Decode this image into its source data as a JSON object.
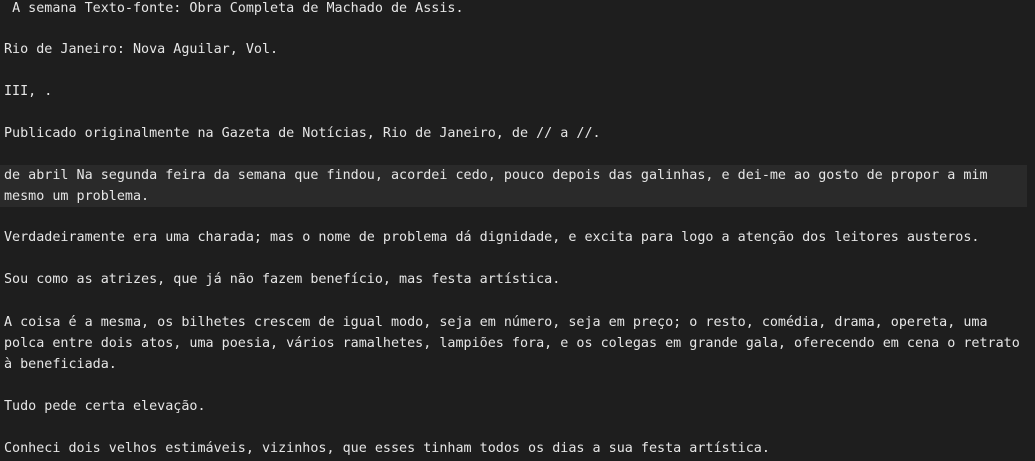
{
  "editor": {
    "paragraphs": [
      " A semana Texto-fonte: Obra Completa de Machado de Assis.",
      "Rio de Janeiro: Nova Aguilar, Vol.",
      "III, .",
      "Publicado originalmente na Gazeta de Notícias, Rio de Janeiro, de // a //.",
      "de abril Na segunda feira da semana que findou, acordei cedo, pouco depois das galinhas, e dei-me ao gosto de propor a mim mesmo um problema.",
      "Verdadeiramente era uma charada; mas o nome de problema dá dignidade, e excita para logo a atenção dos leitores austeros.",
      "Sou como as atrizes, que já não fazem benefício, mas festa artística.",
      "A coisa é a mesma, os bilhetes crescem de igual modo, seja em número, seja em preço; o resto, comédia, drama, opereta, uma polca entre dois atos, uma poesia, vários ramalhetes, lampiões fora, e os colegas em grande gala, oferecendo em cena o retrato à beneficiada.",
      "Tudo pede certa elevação.",
      "Conheci dois velhos estimáveis, vizinhos, que esses tinham todos os dias a sua festa artística."
    ],
    "current_paragraph_index": 4
  }
}
